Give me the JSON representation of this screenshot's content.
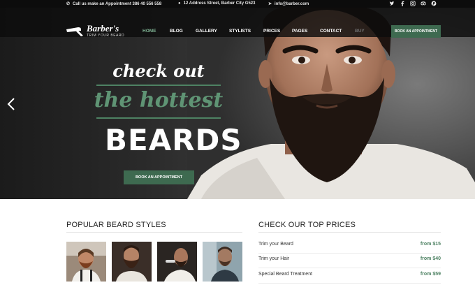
{
  "topbar": {
    "phone": "Call us make an Appointment 386 40 556 558",
    "address": "12 Address Street, Barber City G523",
    "email": "info@barber.com",
    "social_icons": [
      "twitter-icon",
      "facebook-icon",
      "instagram-icon",
      "tripadvisor-icon",
      "pinterest-icon"
    ]
  },
  "logo": {
    "title": "Barber's",
    "subtitle": "TRIM YOUR BEARD"
  },
  "nav": {
    "items": [
      "HOME",
      "BLOG",
      "GALLERY",
      "STYLISTS",
      "PRICES",
      "PAGES",
      "CONTACT",
      "BUY"
    ],
    "active": "HOME",
    "cta": "BOOK AN APPOINTMENT"
  },
  "hero": {
    "line1": "check out",
    "line2": "the hottest",
    "line3": "BEARDS",
    "cta": "BOOK AN APPOINTMENT"
  },
  "styles_section": {
    "title": "POPULAR BEARD STYLES"
  },
  "prices_section": {
    "title": "CHECK OUR TOP PRICES",
    "items": [
      {
        "name": "Trim your Beard",
        "price": "from $15"
      },
      {
        "name": "Trim your Hair",
        "price": "from $40"
      },
      {
        "name": "Special Beard Treatment",
        "price": "from $59"
      }
    ]
  },
  "colors": {
    "accent": "#3e6a50",
    "accent_text": "#5f9474",
    "topbar": "#0c0c0c"
  }
}
